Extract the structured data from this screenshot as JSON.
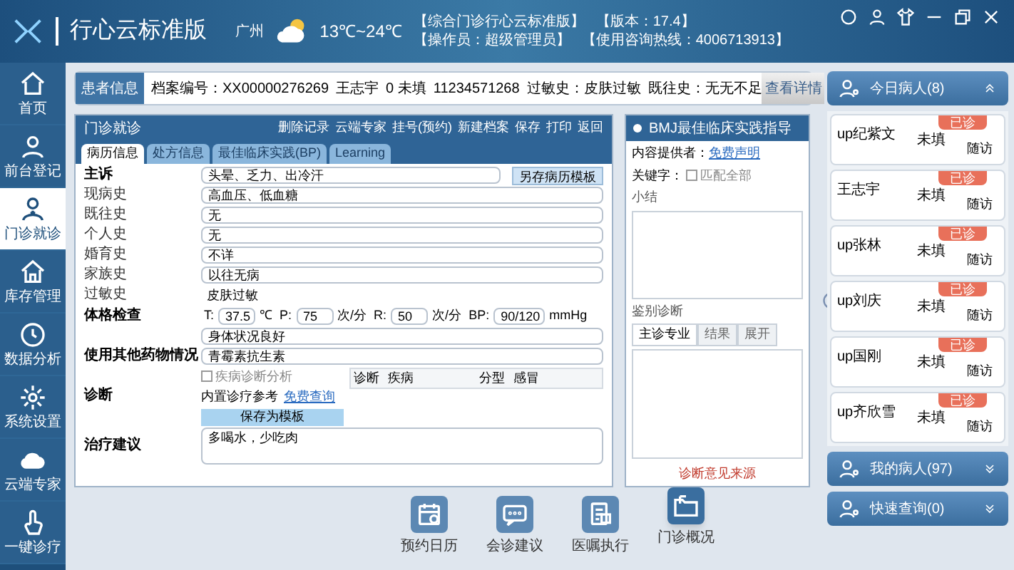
{
  "header": {
    "app_title": "行心云标准版",
    "city": "广州",
    "temperature": "13℃~24℃",
    "info": [
      "【综合门诊行心云标准版】",
      "【版本：17.4】",
      "【操作员：超级管理员】",
      "【使用咨询热线：4006713913】"
    ]
  },
  "sidebar": {
    "items": [
      {
        "label": "首页",
        "selected": false
      },
      {
        "label": "前台登记",
        "selected": false
      },
      {
        "label": "门诊就诊",
        "selected": true
      },
      {
        "label": "库存管理",
        "selected": false
      },
      {
        "label": "数据分析",
        "selected": false
      },
      {
        "label": "系统设置",
        "selected": false
      },
      {
        "label": "云端专家",
        "selected": false
      },
      {
        "label": "一键诊疗",
        "selected": false
      }
    ]
  },
  "patient_bar": {
    "title": "患者信息",
    "fields": [
      "档案编号：XX00000276269",
      "王志宇",
      "0 未填",
      "11234571268",
      "过敏史：皮肤过敏",
      "既往史：无无不足"
    ],
    "button": "查看详情"
  },
  "visit_panel": {
    "title": "门诊就诊",
    "toolbar": [
      "删除记录",
      "云端专家",
      "挂号(预约)",
      "新建档案",
      "保存",
      "打印",
      "返回"
    ],
    "tabs": [
      {
        "label": "病历信息",
        "selected": true
      },
      {
        "label": "处方信息",
        "selected": false
      },
      {
        "label": "最佳临床实践(BP)",
        "selected": false
      },
      {
        "label": "Learning",
        "selected": false
      }
    ],
    "chief_complaint": {
      "label": "主诉",
      "value": "头晕、乏力、出冷汗",
      "button": "另存病历模板"
    },
    "history": [
      {
        "label": "现病史",
        "value": "高血压、低血糖"
      },
      {
        "label": "既往史",
        "value": "无"
      },
      {
        "label": "个人史",
        "value": "无"
      },
      {
        "label": "婚育史",
        "value": "不详"
      },
      {
        "label": "家族史",
        "value": "以往无病"
      }
    ],
    "allergy": {
      "label": "过敏史",
      "value": "皮肤过敏"
    },
    "exam": {
      "label": "体格检查",
      "vitals": [
        {
          "name": "T:",
          "value": "37.5",
          "unit": "℃"
        },
        {
          "name": "P:",
          "value": "75",
          "unit": "次/分"
        },
        {
          "name": "R:",
          "value": "50",
          "unit": "次/分"
        },
        {
          "name": "BP:",
          "value": "90/120",
          "unit": "mmHg"
        }
      ],
      "note": "身体状况良好"
    },
    "other_drugs": {
      "label": "使用其他药物情况",
      "value": "青霉素抗生素"
    },
    "diagnosis": {
      "label": "诊断",
      "checkbox": {
        "label": "疾病诊断分析",
        "checked": false
      },
      "reference": "内置诊疗参考",
      "link": "免费查询",
      "button": "保存为模板",
      "cells": [
        "诊断",
        "疾病",
        "分型",
        "感冒"
      ]
    },
    "treatment": {
      "label": "治疗建议",
      "value": "多喝水，少吃肉"
    }
  },
  "bmj_panel": {
    "title": "BMJ最佳临床实践指导",
    "provider_label": "内容提供者：",
    "provider_link": "免费声明",
    "keyword_label": "关键字：",
    "keyword_checkbox": {
      "label": "匹配全部",
      "checked": false
    },
    "summary_label": "小结",
    "differential_label": "鉴别诊断",
    "tabs": [
      {
        "label": "主诊专业",
        "selected": true
      },
      {
        "label": "结果",
        "selected": false
      },
      {
        "label": "展开",
        "selected": false
      }
    ],
    "footer": "诊断意见来源"
  },
  "bottom_bar": [
    {
      "label": "预约日历",
      "selected": false
    },
    {
      "label": "会诊建议",
      "selected": false
    },
    {
      "label": "医嘱执行",
      "selected": false
    },
    {
      "label": "门诊概况",
      "selected": true
    }
  ],
  "right_panel": {
    "sections": [
      {
        "title": "今日病人(8)",
        "expanded": true,
        "patients": [
          {
            "name": "up纪紫文",
            "status": "未填",
            "badge": "已诊",
            "action": "随访"
          },
          {
            "name": "王志宇",
            "status": "未填",
            "badge": "已诊",
            "action": "随访"
          },
          {
            "name": "up张林",
            "status": "未填",
            "badge": "已诊",
            "action": "随访"
          },
          {
            "name": "up刘庆",
            "status": "未填",
            "badge": "已诊",
            "action": "随访"
          },
          {
            "name": "up国刚",
            "status": "未填",
            "badge": "已诊",
            "action": "随访"
          },
          {
            "name": "up齐欣雪",
            "status": "未填",
            "badge": "已诊",
            "action": "随访"
          }
        ]
      },
      {
        "title": "我的病人(97)",
        "expanded": false
      },
      {
        "title": "快速查询(0)",
        "expanded": false
      }
    ]
  }
}
